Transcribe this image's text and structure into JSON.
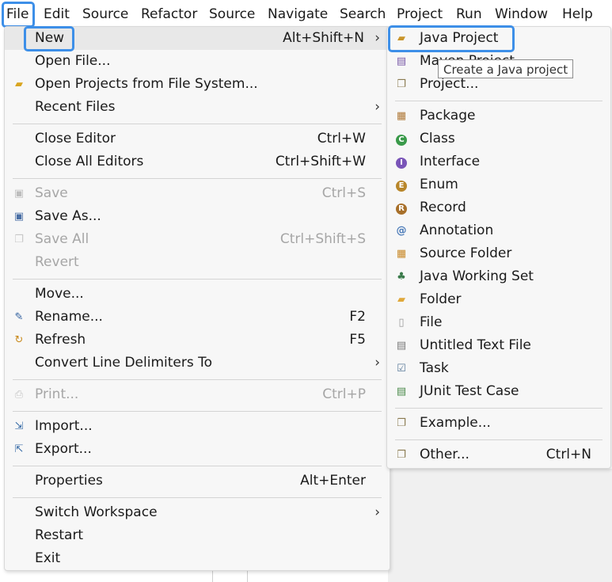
{
  "menubar": [
    "File",
    "Edit",
    "Source",
    "Refactor",
    "Source",
    "Navigate",
    "Search",
    "Project",
    "Run",
    "Window",
    "Help"
  ],
  "file_menu": {
    "new": {
      "label": "New",
      "shortcut": "Alt+Shift+N"
    },
    "open_file": {
      "label": "Open File..."
    },
    "open_projects": {
      "label": "Open Projects from File System..."
    },
    "recent_files": {
      "label": "Recent Files"
    },
    "close_editor": {
      "label": "Close Editor",
      "shortcut": "Ctrl+W"
    },
    "close_all": {
      "label": "Close All Editors",
      "shortcut": "Ctrl+Shift+W"
    },
    "save": {
      "label": "Save",
      "shortcut": "Ctrl+S"
    },
    "save_as": {
      "label": "Save As..."
    },
    "save_all": {
      "label": "Save All",
      "shortcut": "Ctrl+Shift+S"
    },
    "revert": {
      "label": "Revert"
    },
    "move": {
      "label": "Move..."
    },
    "rename": {
      "label": "Rename...",
      "shortcut": "F2"
    },
    "refresh": {
      "label": "Refresh",
      "shortcut": "F5"
    },
    "convert": {
      "label": "Convert Line Delimiters To"
    },
    "print": {
      "label": "Print...",
      "shortcut": "Ctrl+P"
    },
    "import": {
      "label": "Import..."
    },
    "export": {
      "label": "Export..."
    },
    "properties": {
      "label": "Properties",
      "shortcut": "Alt+Enter"
    },
    "switch_workspace": {
      "label": "Switch Workspace"
    },
    "restart": {
      "label": "Restart"
    },
    "exit": {
      "label": "Exit"
    },
    "arrow": "›"
  },
  "new_menu": {
    "java_project": "Java Project",
    "maven_project": "Maven Project",
    "project": "Project...",
    "package": "Package",
    "class": "Class",
    "interface": "Interface",
    "enum": "Enum",
    "record": "Record",
    "annotation": "Annotation",
    "source_folder": "Source Folder",
    "java_working_set": "Java Working Set",
    "folder": "Folder",
    "file": "File",
    "untitled_text_file": "Untitled Text File",
    "task": "Task",
    "junit_test_case": "JUnit Test Case",
    "example": "Example...",
    "other": {
      "label": "Other...",
      "shortcut": "Ctrl+N"
    }
  },
  "tooltip": "Create a Java project",
  "colors": {
    "accent": "#3d8fe8",
    "menu_bg": "#f7f7f7",
    "disabled": "#a6a6a6"
  }
}
